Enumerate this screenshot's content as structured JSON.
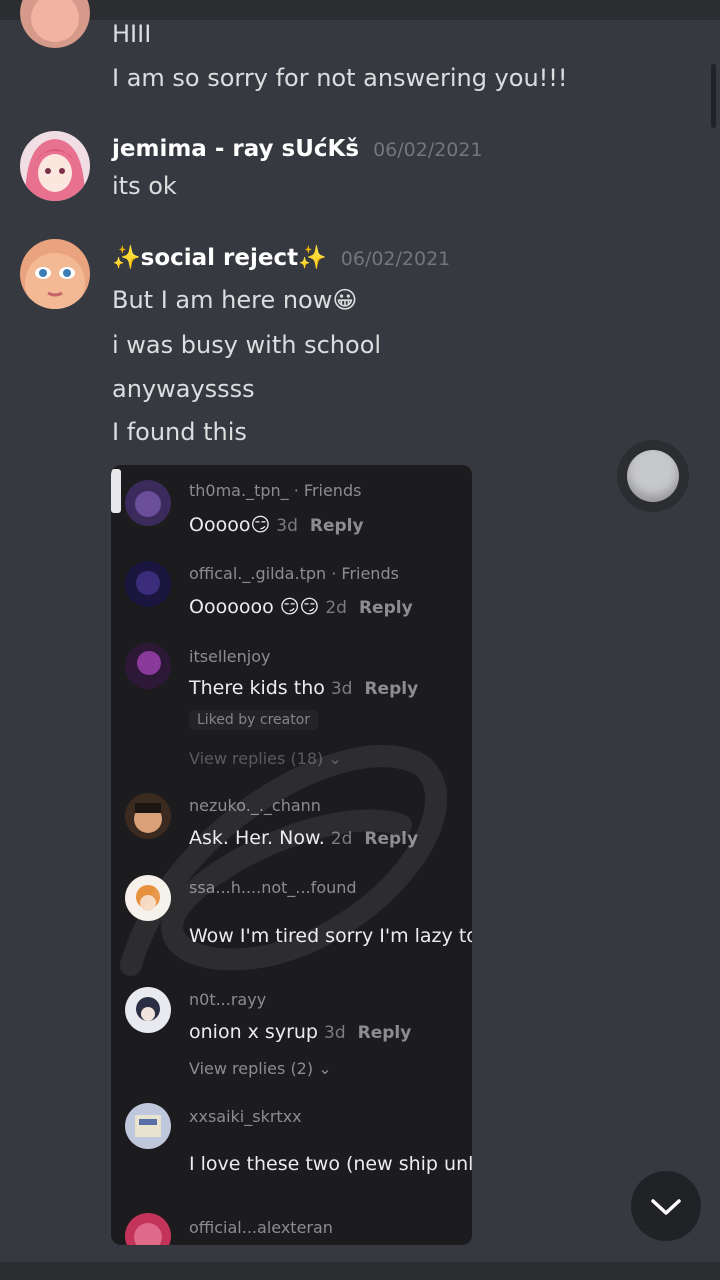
{
  "messages": {
    "first": {
      "lines": [
        "HIII",
        "I am so sorry for not answering you!!!"
      ]
    },
    "second": {
      "author": "jemima - ray sUćKš",
      "timestamp": "06/02/2021",
      "lines": [
        "its ok"
      ]
    },
    "third": {
      "author_prefix": "✨",
      "author": "social reject",
      "author_suffix": "✨",
      "timestamp": "06/02/2021",
      "lines": [
        "But I am here now😀",
        "i was busy with school",
        "anywayssss",
        "I found this"
      ]
    }
  },
  "embedded_comments": [
    {
      "user": "th0ma._tpn_",
      "tag": " · Friends",
      "text": "Ooooo😏",
      "age": "3d",
      "reply": "Reply"
    },
    {
      "user": "offical._.gilda.tpn",
      "tag": " · Friends",
      "text": "Ooooooo 😏😏",
      "age": "2d",
      "reply": "Reply"
    },
    {
      "user": "itsellenjoy",
      "text": "There kids tho",
      "age": "3d",
      "reply": "Reply",
      "liked": "Liked by creator",
      "view_replies": "View replies (18) ⌄"
    },
    {
      "user": "nezuko._._chann",
      "text": "Ask. Her. Now.",
      "age": "2d",
      "reply": "Reply"
    },
    {
      "user": "ssa...h....not_...found",
      "text": "Wow I'm tired sorry I'm lazy to"
    },
    {
      "user": "n0t...rayy",
      "text": "onion x syrup",
      "age": "3d",
      "reply": "Reply",
      "view_replies": "View replies (2) ⌄"
    },
    {
      "user": "xxsaiki_skrtxx",
      "text": "I love these two (new ship unl"
    },
    {
      "user": "official...alexteran"
    }
  ],
  "colors": {
    "background": "#36393f",
    "embed": "#1c1b1e",
    "author": "#ffffff",
    "timestamp": "#72767d"
  },
  "icons": {
    "jump": "chevron-down-icon",
    "float": "floating-bubble-icon"
  }
}
